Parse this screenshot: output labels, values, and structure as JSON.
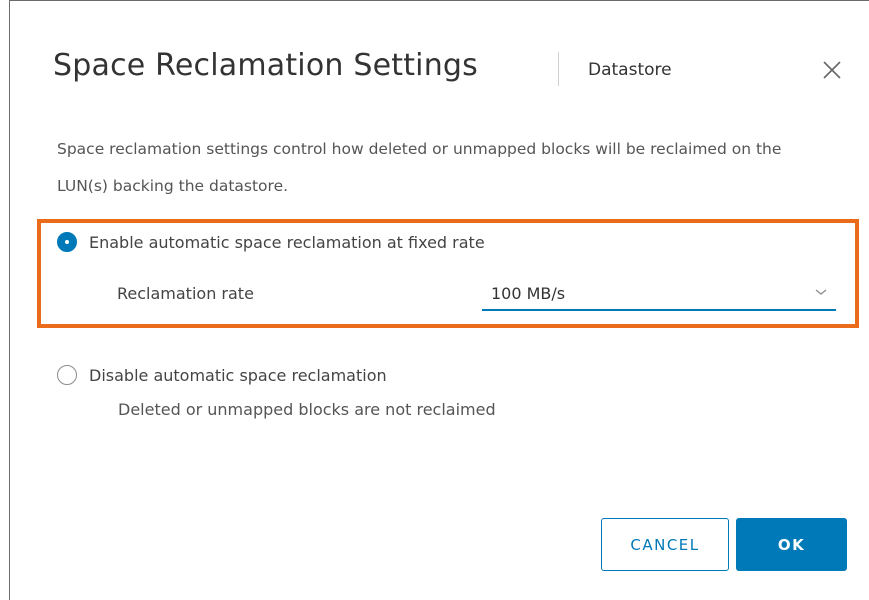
{
  "dialog": {
    "title": "Space Reclamation Settings",
    "subtitle": "Datastore",
    "close_icon": "close-icon",
    "description": "Space reclamation settings control how deleted or unmapped blocks will be reclaimed on the LUN(s) backing the datastore."
  },
  "options": {
    "enable": {
      "label": "Enable automatic space reclamation at fixed rate",
      "selected": true,
      "rate_label": "Reclamation rate",
      "rate_value": "100 MB/s",
      "dropdown_icon": "chevron-down-icon"
    },
    "disable": {
      "label": "Disable automatic space reclamation",
      "selected": false,
      "note": "Deleted or unmapped blocks are not reclaimed"
    }
  },
  "buttons": {
    "cancel": "CANCEL",
    "ok": "OK"
  },
  "colors": {
    "accent": "#0079b8",
    "highlight": "#ea6b1a",
    "text": "#333333"
  }
}
